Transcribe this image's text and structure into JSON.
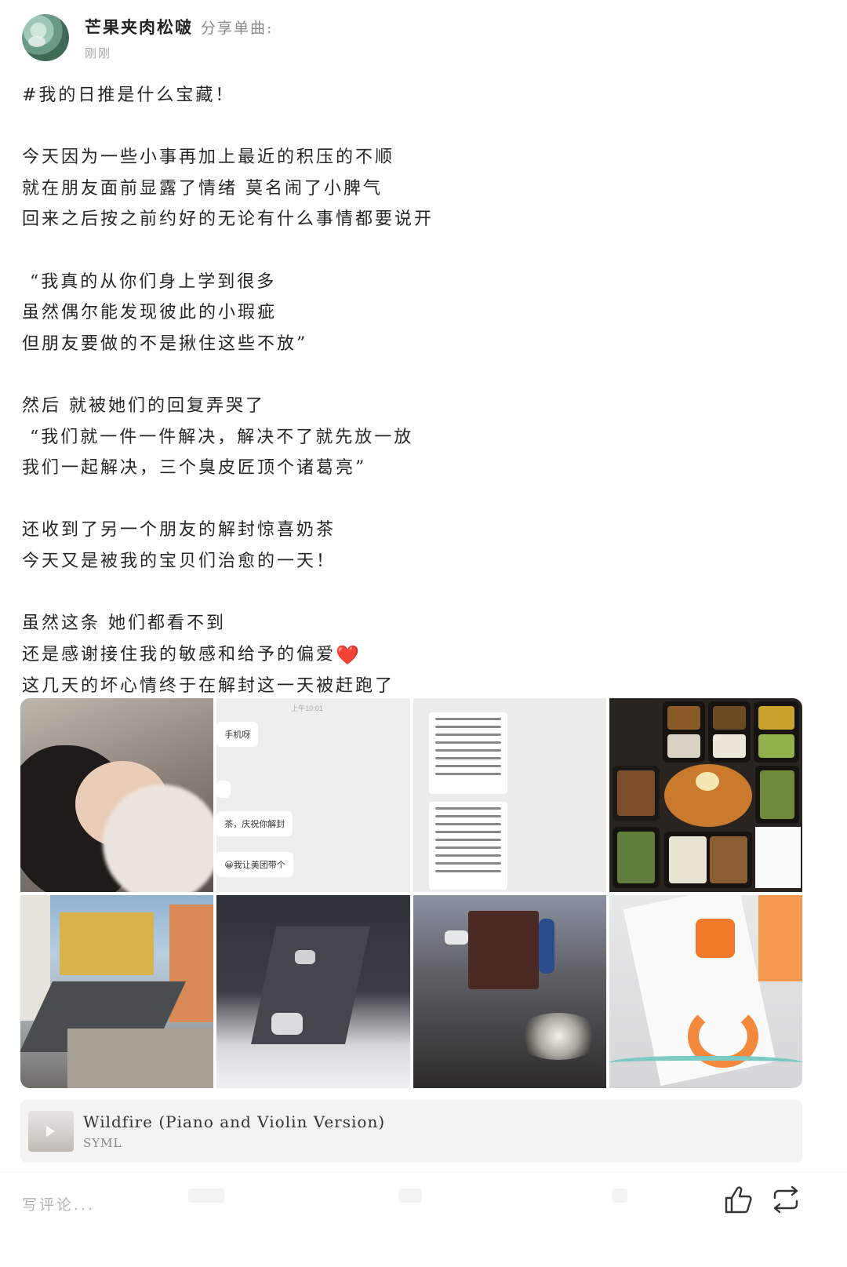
{
  "header": {
    "username": "芒果夹肉松啵",
    "action": "分享单曲:",
    "time": "刚刚"
  },
  "post": {
    "lines": [
      "#我的日推是什么宝藏！",
      "",
      "今天因为一些小事再加上最近的积压的不顺",
      "就在朋友面前显露了情绪 莫名闹了小脾气",
      "回来之后按之前约好的无论有什么事情都要说开",
      "",
      " “我真的从你们身上学到很多",
      "虽然偶尔能发现彼此的小瑕疵",
      "但朋友要做的不是揪住这些不放”",
      "",
      "然后 就被她们的回复弄哭了",
      " “我们就一件一件解决，解决不了就先放一放",
      "我们一起解决，三个臭皮匠顶个诸葛亮”",
      "",
      "还收到了另一个朋友的解封惊喜奶茶",
      "今天又是被我的宝贝们治愈的一天！",
      "",
      "虽然这条 她们都看不到",
      "还是感谢接住我的敏感和给予的偏爱",
      "这几天的坏心情终于在解封这一天被赶跑了"
    ],
    "heart_emoji": "❤️"
  },
  "photos": {
    "chat": {
      "top_label": "上午10:01",
      "bubble1": "手机呀",
      "bubble2": "茶，庆祝你解封",
      "bubble3": "😀我让美团带个"
    }
  },
  "music": {
    "title": "Wildfire (Piano and Violin Version)",
    "artist": "SYML"
  },
  "bottom_bar": {
    "comment_placeholder": "写评论...",
    "icons": [
      "thumbs-up-icon",
      "repost-icon"
    ]
  }
}
